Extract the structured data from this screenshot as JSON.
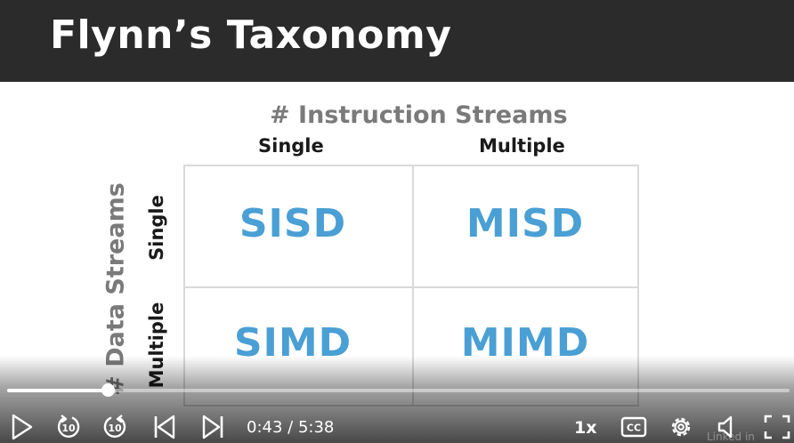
{
  "slide": {
    "title": "Flynn’s Taxonomy",
    "x_axis_title": "# Instruction Streams",
    "y_axis_title": "# Data Streams",
    "columns": [
      "Single",
      "Multiple"
    ],
    "rows": [
      "Single",
      "Multiple"
    ],
    "cells": {
      "single_single": "SISD",
      "single_multiple": "MISD",
      "multiple_single": "SIMD",
      "multiple_multiple": "MIMD"
    },
    "colors": {
      "title_bar": "#2b2b2b",
      "axis_title": "#7a7a7a",
      "cell_text": "#4a9fd4",
      "grid_line": "#d9d9d9"
    }
  },
  "player": {
    "progress": 0.128,
    "current_time": "0:43",
    "separator": " / ",
    "duration": "5:38",
    "speed": "1x",
    "watermark": "Linked in",
    "icons": [
      "play-icon",
      "rewind-10-icon",
      "forward-10-icon",
      "previous-icon",
      "next-icon",
      "captions-icon",
      "settings-gear-icon",
      "volume-icon",
      "fullscreen-icon"
    ]
  }
}
